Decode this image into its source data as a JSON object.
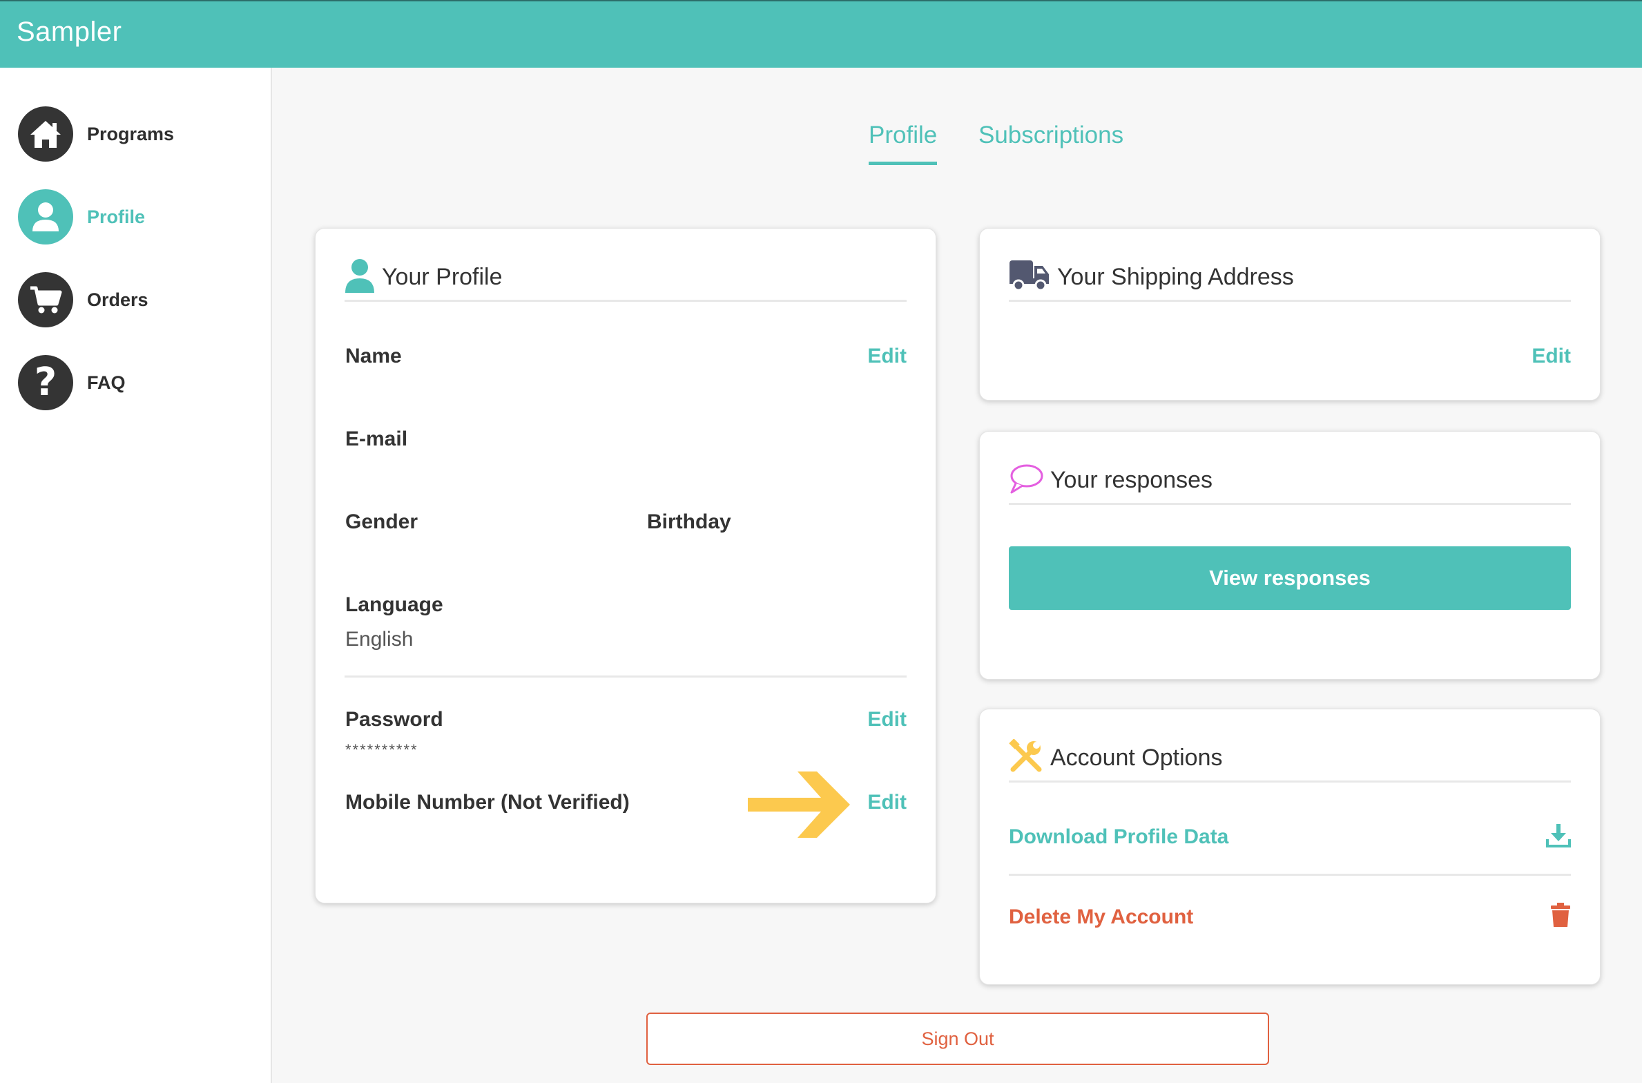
{
  "app": {
    "logo_text": "Sampler"
  },
  "colors": {
    "brand": "#4fc1b8",
    "danger": "#e06140",
    "arrow": "#fcc94e",
    "chat_icon": "#e45fe0",
    "dark": "#343434"
  },
  "sidebar": {
    "items": [
      {
        "label": "Programs",
        "icon": "home-icon"
      },
      {
        "label": "Profile",
        "icon": "user-icon",
        "active": true
      },
      {
        "label": "Orders",
        "icon": "cart-icon"
      },
      {
        "label": "FAQ",
        "icon": "question-icon"
      }
    ]
  },
  "tabs": [
    {
      "label": "Profile",
      "active": true
    },
    {
      "label": "Subscriptions"
    }
  ],
  "profile_card": {
    "title": "Your Profile",
    "name_label": "Name",
    "name_edit": "Edit",
    "email_label": "E-mail",
    "gender_label": "Gender",
    "birthday_label": "Birthday",
    "language_label": "Language",
    "language_value": "English",
    "password_label": "Password",
    "password_edit": "Edit",
    "password_value": "**********",
    "mobile_label": "Mobile Number (Not Verified)",
    "mobile_edit": "Edit"
  },
  "shipping_card": {
    "title": "Your Shipping Address",
    "edit": "Edit"
  },
  "responses_card": {
    "title": "Your responses",
    "button": "View responses"
  },
  "account_card": {
    "title": "Account Options",
    "download": "Download Profile Data",
    "delete": "Delete My Account"
  },
  "sign_out": "Sign Out"
}
